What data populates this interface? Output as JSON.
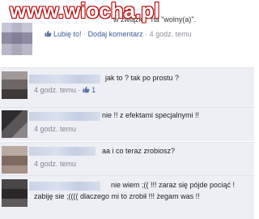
{
  "watermark": {
    "text": "www.wiocha.pl"
  },
  "story": {
    "status_text": "w związku\" na \"wolny(a)\".",
    "like_label": "Lubię to!",
    "separator": "·",
    "comment_label": "Dodaj komentarz",
    "time": "4 godz. temu"
  },
  "comments": [
    {
      "text": "jak to ? tak po prostu ?",
      "time": "4 godz. temu",
      "separator": "·",
      "like_count": "1"
    },
    {
      "text": "nie !! z efektami specjalnymi !!",
      "time": "4 godz. temu"
    },
    {
      "text": "aa i co teraz zrobiosz?",
      "time": "4 godz. temu"
    },
    {
      "text_line1": "nie wiem ;(( !!! zaraz się pójde pociąć !",
      "text_line2": "zabiję sie ;(((( dlaczego mi to zrobił !!!  żegam was !!"
    }
  ],
  "colors": {
    "link": "#3b5998",
    "comment_bg": "#edeff4",
    "meta": "#8a8f99",
    "watermark": "#c00000"
  },
  "icons": {
    "like": "thumbs-up-icon"
  }
}
